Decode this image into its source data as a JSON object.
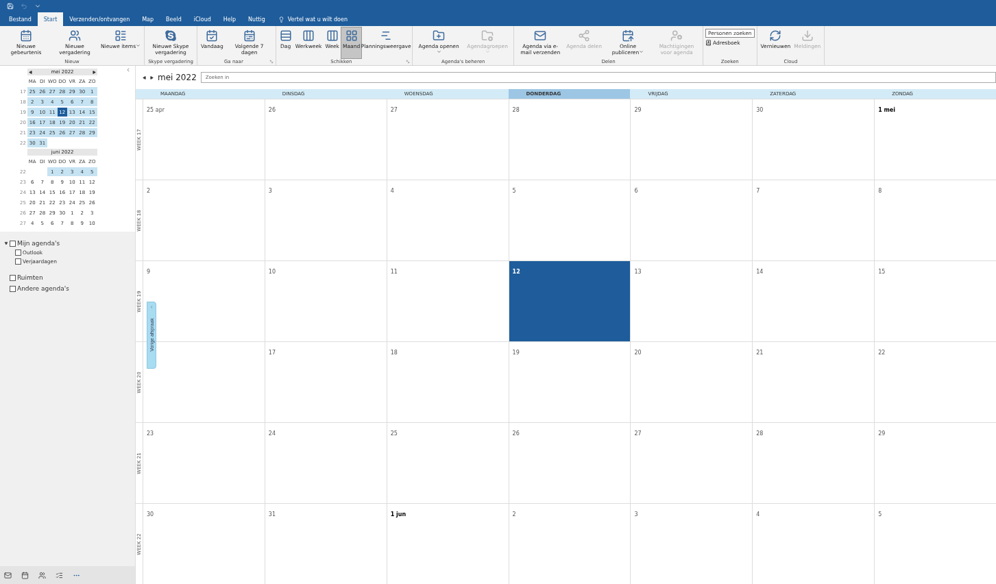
{
  "quick_access": {
    "items": [
      {
        "kind": "save"
      },
      {
        "kind": "undo",
        "disabled": true
      },
      {
        "kind": "customize"
      }
    ]
  },
  "tabs": [
    {
      "label": "Bestand",
      "selected": false
    },
    {
      "label": "Start",
      "selected": true
    },
    {
      "label": "Verzenden/ontvangen",
      "selected": false
    },
    {
      "label": "Map",
      "selected": false
    },
    {
      "label": "Beeld",
      "selected": false
    },
    {
      "label": "iCloud",
      "selected": false
    },
    {
      "label": "Help",
      "selected": false
    },
    {
      "label": "Nuttig",
      "selected": false
    }
  ],
  "tell_me": "Vertel wat u wilt doen",
  "ribbon_groups": [
    {
      "label": "Nieuw",
      "launcher": false,
      "buttons": [
        {
          "kind": "event",
          "label": "Nieuwe gebeurtenis",
          "disabled": false,
          "selected": false,
          "dropdown": false
        },
        {
          "kind": "meeting",
          "label": "Nieuwe vergadering",
          "disabled": false,
          "selected": false,
          "dropdown": false
        },
        {
          "kind": "items",
          "label": "Nieuwe items",
          "disabled": false,
          "selected": false,
          "dropdown": true
        }
      ]
    },
    {
      "label": "Skype vergadering",
      "launcher": false,
      "buttons": [
        {
          "kind": "skype",
          "label": "Nieuwe Skype vergadering",
          "disabled": false,
          "selected": false,
          "dropdown": false
        }
      ]
    },
    {
      "label": "Ga naar",
      "launcher": true,
      "buttons": [
        {
          "kind": "today",
          "label": "Vandaag",
          "disabled": false,
          "selected": false,
          "dropdown": false
        },
        {
          "kind": "next7",
          "label": "Volgende 7 dagen",
          "disabled": false,
          "selected": false,
          "dropdown": false
        }
      ]
    },
    {
      "label": "Schikken",
      "launcher": true,
      "buttons": [
        {
          "kind": "day",
          "label": "Dag",
          "disabled": false,
          "selected": false,
          "dropdown": false
        },
        {
          "kind": "workweek",
          "label": "Werkweek",
          "disabled": false,
          "selected": false,
          "dropdown": false
        },
        {
          "kind": "week",
          "label": "Week",
          "disabled": false,
          "selected": false,
          "dropdown": false
        },
        {
          "kind": "month",
          "label": "Maand",
          "disabled": false,
          "selected": true,
          "dropdown": false
        },
        {
          "kind": "schedule",
          "label": "Planningsweergave",
          "disabled": false,
          "selected": false,
          "dropdown": false
        }
      ]
    },
    {
      "label": "Agenda's beheren",
      "launcher": false,
      "buttons": [
        {
          "kind": "open",
          "label": "Agenda openen",
          "disabled": false,
          "selected": false,
          "dropdown": true
        },
        {
          "kind": "groups",
          "label": "Agendagroepen",
          "disabled": true,
          "selected": false,
          "dropdown": true
        }
      ]
    },
    {
      "label": "Delen",
      "launcher": false,
      "buttons": [
        {
          "kind": "email",
          "label": "Agenda via e-mail verzenden",
          "disabled": false,
          "selected": false,
          "dropdown": false
        },
        {
          "kind": "share",
          "label": "Agenda delen",
          "disabled": true,
          "selected": false,
          "dropdown": false
        },
        {
          "kind": "publish",
          "label": "Online publiceren",
          "disabled": false,
          "selected": false,
          "dropdown": true
        },
        {
          "kind": "permissions",
          "label": "Machtigingen voor agenda",
          "disabled": true,
          "selected": false,
          "dropdown": false
        }
      ]
    },
    {
      "label": "Zoeken",
      "launcher": false,
      "buttons": [
        {
          "kind": "people_search",
          "label": "Personen zoeken",
          "disabled": false,
          "selected": false,
          "dropdown": false
        },
        {
          "kind": "addressbook",
          "label": "Adresboek",
          "disabled": false,
          "selected": false,
          "dropdown": false
        }
      ]
    },
    {
      "label": "Cloud",
      "launcher": false,
      "buttons": [
        {
          "kind": "refresh",
          "label": "Vernieuwen",
          "disabled": false,
          "selected": false,
          "dropdown": false
        },
        {
          "kind": "notifications",
          "label": "Meldingen",
          "disabled": true,
          "selected": false,
          "dropdown": false
        }
      ]
    }
  ],
  "mini_calendars": [
    {
      "title": "mei 2022",
      "weekdays": [
        "MA",
        "DI",
        "WO",
        "DO",
        "VR",
        "ZA",
        "ZO"
      ],
      "weeks": [
        {
          "number": "17",
          "days": [
            {
              "label": "25",
              "in_view": true,
              "today": false
            },
            {
              "label": "26",
              "in_view": true,
              "today": false
            },
            {
              "label": "27",
              "in_view": true,
              "today": false
            },
            {
              "label": "28",
              "in_view": true,
              "today": false
            },
            {
              "label": "29",
              "in_view": true,
              "today": false
            },
            {
              "label": "30",
              "in_view": true,
              "today": false
            },
            {
              "label": "1",
              "in_view": true,
              "today": false
            }
          ]
        },
        {
          "number": "18",
          "days": [
            {
              "label": "2",
              "in_view": true,
              "today": false
            },
            {
              "label": "3",
              "in_view": true,
              "today": false
            },
            {
              "label": "4",
              "in_view": true,
              "today": false
            },
            {
              "label": "5",
              "in_view": true,
              "today": false
            },
            {
              "label": "6",
              "in_view": true,
              "today": false
            },
            {
              "label": "7",
              "in_view": true,
              "today": false
            },
            {
              "label": "8",
              "in_view": true,
              "today": false
            }
          ]
        },
        {
          "number": "19",
          "days": [
            {
              "label": "9",
              "in_view": true,
              "today": false
            },
            {
              "label": "10",
              "in_view": true,
              "today": false
            },
            {
              "label": "11",
              "in_view": true,
              "today": false
            },
            {
              "label": "12",
              "in_view": true,
              "today": true
            },
            {
              "label": "13",
              "in_view": true,
              "today": false
            },
            {
              "label": "14",
              "in_view": true,
              "today": false
            },
            {
              "label": "15",
              "in_view": true,
              "today": false
            }
          ]
        },
        {
          "number": "20",
          "days": [
            {
              "label": "16",
              "in_view": true,
              "today": false
            },
            {
              "label": "17",
              "in_view": true,
              "today": false
            },
            {
              "label": "18",
              "in_view": true,
              "today": false
            },
            {
              "label": "19",
              "in_view": true,
              "today": false
            },
            {
              "label": "20",
              "in_view": true,
              "today": false
            },
            {
              "label": "21",
              "in_view": true,
              "today": false
            },
            {
              "label": "22",
              "in_view": true,
              "today": false
            }
          ]
        },
        {
          "number": "21",
          "days": [
            {
              "label": "23",
              "in_view": true,
              "today": false
            },
            {
              "label": "24",
              "in_view": true,
              "today": false
            },
            {
              "label": "25",
              "in_view": true,
              "today": false
            },
            {
              "label": "26",
              "in_view": true,
              "today": false
            },
            {
              "label": "27",
              "in_view": true,
              "today": false
            },
            {
              "label": "28",
              "in_view": true,
              "today": false
            },
            {
              "label": "29",
              "in_view": true,
              "today": false
            }
          ]
        },
        {
          "number": "22",
          "days": [
            {
              "label": "30",
              "in_view": true,
              "today": false
            },
            {
              "label": "31",
              "in_view": true,
              "today": false
            }
          ]
        }
      ]
    },
    {
      "title": "juni 2022",
      "weekdays": [
        "MA",
        "DI",
        "WO",
        "DO",
        "VR",
        "ZA",
        "ZO"
      ],
      "weeks": [
        {
          "number": "22",
          "days": [
            {
              "kind": "blank"
            },
            {
              "kind": "blank"
            },
            {
              "label": "1",
              "in_view": true,
              "today": false
            },
            {
              "label": "2",
              "in_view": true,
              "today": false
            },
            {
              "label": "3",
              "in_view": true,
              "today": false
            },
            {
              "label": "4",
              "in_view": true,
              "today": false
            },
            {
              "label": "5",
              "in_view": true,
              "today": false
            }
          ]
        },
        {
          "number": "23",
          "days": [
            {
              "label": "6",
              "in_view": false,
              "today": false
            },
            {
              "label": "7",
              "in_view": false,
              "today": false
            },
            {
              "label": "8",
              "in_view": false,
              "today": false
            },
            {
              "label": "9",
              "in_view": false,
              "today": false
            },
            {
              "label": "10",
              "in_view": false,
              "today": false
            },
            {
              "label": "11",
              "in_view": false,
              "today": false
            },
            {
              "label": "12",
              "in_view": false,
              "today": false
            }
          ]
        },
        {
          "number": "24",
          "days": [
            {
              "label": "13",
              "in_view": false,
              "today": false
            },
            {
              "label": "14",
              "in_view": false,
              "today": false
            },
            {
              "label": "15",
              "in_view": false,
              "today": false
            },
            {
              "label": "16",
              "in_view": false,
              "today": false
            },
            {
              "label": "17",
              "in_view": false,
              "today": false
            },
            {
              "label": "18",
              "in_view": false,
              "today": false
            },
            {
              "label": "19",
              "in_view": false,
              "today": false
            }
          ]
        },
        {
          "number": "25",
          "days": [
            {
              "label": "20",
              "in_view": false,
              "today": false
            },
            {
              "label": "21",
              "in_view": false,
              "today": false
            },
            {
              "label": "22",
              "in_view": false,
              "today": false
            },
            {
              "label": "23",
              "in_view": false,
              "today": false
            },
            {
              "label": "24",
              "in_view": false,
              "today": false
            },
            {
              "label": "25",
              "in_view": false,
              "today": false
            },
            {
              "label": "26",
              "in_view": false,
              "today": false
            }
          ]
        },
        {
          "number": "26",
          "days": [
            {
              "label": "27",
              "in_view": false,
              "today": false
            },
            {
              "label": "28",
              "in_view": false,
              "today": false
            },
            {
              "label": "29",
              "in_view": false,
              "today": false
            },
            {
              "label": "30",
              "in_view": false,
              "today": false
            },
            {
              "label": "1",
              "in_view": false,
              "today": false
            },
            {
              "label": "2",
              "in_view": false,
              "today": false
            },
            {
              "label": "3",
              "in_view": false,
              "today": false
            }
          ]
        },
        {
          "number": "27",
          "days": [
            {
              "label": "4",
              "in_view": false,
              "today": false
            },
            {
              "label": "5",
              "in_view": false,
              "today": false
            },
            {
              "label": "6",
              "in_view": false,
              "today": false
            },
            {
              "label": "7",
              "in_view": false,
              "today": false
            },
            {
              "label": "8",
              "in_view": false,
              "today": false
            },
            {
              "label": "9",
              "in_view": false,
              "today": false
            },
            {
              "label": "10",
              "in_view": false,
              "today": false
            }
          ]
        }
      ]
    }
  ],
  "folders": [
    {
      "label": "Mijn agenda's",
      "checked": false,
      "expanded": true,
      "children": [
        {
          "label": "Outlook",
          "checked": false
        },
        {
          "label": "Verjaardagen",
          "checked": false
        }
      ]
    },
    {
      "label": "Ruimten",
      "checked": false,
      "expanded": false
    },
    {
      "label": "Andere agenda's",
      "checked": false,
      "expanded": false
    }
  ],
  "nav_bar": [
    {
      "kind": "mail"
    },
    {
      "kind": "calendar"
    },
    {
      "kind": "people"
    },
    {
      "kind": "tasks"
    },
    {
      "kind": "more"
    }
  ],
  "calendar": {
    "title": "mei 2022",
    "search": {
      "placeholder": "Zoeken in"
    },
    "weekdays": [
      {
        "label": "MAANDAG",
        "selected": false
      },
      {
        "label": "DINSDAG",
        "selected": false
      },
      {
        "label": "WOENSDAG",
        "selected": false
      },
      {
        "label": "DONDERDAG",
        "selected": true
      },
      {
        "label": "VRIJDAG",
        "selected": false
      },
      {
        "label": "ZATERDAG",
        "selected": false
      },
      {
        "label": "ZONDAG",
        "selected": false
      }
    ],
    "previous_appointment": "Vorige afspraak",
    "weeks": [
      {
        "label": "WEEK 17",
        "days": [
          {
            "label": "25 apr",
            "month_start": false,
            "selected": false
          },
          {
            "label": "26",
            "month_start": false,
            "selected": false
          },
          {
            "label": "27",
            "month_start": false,
            "selected": false
          },
          {
            "label": "28",
            "month_start": false,
            "selected": false
          },
          {
            "label": "29",
            "month_start": false,
            "selected": false
          },
          {
            "label": "30",
            "month_start": false,
            "selected": false
          },
          {
            "label": "1 mei",
            "month_start": true,
            "selected": false
          }
        ]
      },
      {
        "label": "WEEK 18",
        "days": [
          {
            "label": "2",
            "month_start": false,
            "selected": false
          },
          {
            "label": "3",
            "month_start": false,
            "selected": false
          },
          {
            "label": "4",
            "month_start": false,
            "selected": false
          },
          {
            "label": "5",
            "month_start": false,
            "selected": false
          },
          {
            "label": "6",
            "month_start": false,
            "selected": false
          },
          {
            "label": "7",
            "month_start": false,
            "selected": false
          },
          {
            "label": "8",
            "month_start": false,
            "selected": false
          }
        ]
      },
      {
        "label": "WEEK 19",
        "days": [
          {
            "label": "9",
            "month_start": false,
            "selected": false
          },
          {
            "label": "10",
            "month_start": false,
            "selected": false
          },
          {
            "label": "11",
            "month_start": false,
            "selected": false
          },
          {
            "label": "12",
            "month_start": false,
            "selected": true
          },
          {
            "label": "13",
            "month_start": false,
            "selected": false
          },
          {
            "label": "14",
            "month_start": false,
            "selected": false
          },
          {
            "label": "15",
            "month_start": false,
            "selected": false
          }
        ]
      },
      {
        "label": "WEEK 20",
        "days": [
          {
            "selected": false
          },
          {
            "label": "17",
            "month_start": false,
            "selected": false
          },
          {
            "label": "18",
            "month_start": false,
            "selected": false
          },
          {
            "label": "19",
            "month_start": false,
            "selected": false
          },
          {
            "label": "20",
            "month_start": false,
            "selected": false
          },
          {
            "label": "21",
            "month_start": false,
            "selected": false
          },
          {
            "label": "22",
            "month_start": false,
            "selected": false
          }
        ]
      },
      {
        "label": "WEEK 21",
        "days": [
          {
            "label": "23",
            "month_start": false,
            "selected": false
          },
          {
            "label": "24",
            "month_start": false,
            "selected": false
          },
          {
            "label": "25",
            "month_start": false,
            "selected": false
          },
          {
            "label": "26",
            "month_start": false,
            "selected": false
          },
          {
            "label": "27",
            "month_start": false,
            "selected": false
          },
          {
            "label": "28",
            "month_start": false,
            "selected": false
          },
          {
            "label": "29",
            "month_start": false,
            "selected": false
          }
        ]
      },
      {
        "label": "WEEK 22",
        "days": [
          {
            "label": "30",
            "month_start": false,
            "selected": false
          },
          {
            "label": "31",
            "month_start": false,
            "selected": false
          },
          {
            "label": "1 jun",
            "month_start": true,
            "selected": false
          },
          {
            "label": "2",
            "month_start": false,
            "selected": false
          },
          {
            "label": "3",
            "month_start": false,
            "selected": false
          },
          {
            "label": "4",
            "month_start": false,
            "selected": false
          },
          {
            "label": "5",
            "month_start": false,
            "selected": false
          }
        ]
      }
    ]
  }
}
